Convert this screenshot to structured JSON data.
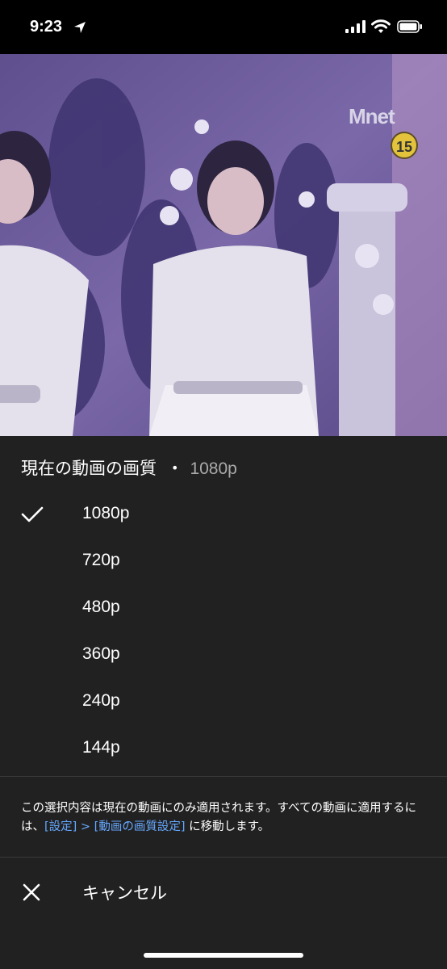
{
  "status_bar": {
    "time": "9:23"
  },
  "video": {
    "channel_logo": "Mnet",
    "age_rating": "15"
  },
  "quality_sheet": {
    "header_label": "現在の動画の画質",
    "separator": "•",
    "current_quality": "1080p",
    "options": [
      {
        "label": "1080p",
        "selected": true
      },
      {
        "label": "720p",
        "selected": false
      },
      {
        "label": "480p",
        "selected": false
      },
      {
        "label": "360p",
        "selected": false
      },
      {
        "label": "240p",
        "selected": false
      },
      {
        "label": "144p",
        "selected": false
      }
    ],
    "note_text": "この選択内容は現在の動画にのみ適用されます。すべての動画に適用するには、",
    "note_link": "[設定] > [動画の画質設定]",
    "note_suffix": " に移動します。",
    "cancel_label": "キャンセル"
  },
  "colors": {
    "sheet_background": "#212121",
    "link": "#65a8ff",
    "secondary_text": "#aaaaaa"
  },
  "icons": [
    "location-arrow-icon",
    "signal-icon",
    "wifi-icon",
    "battery-icon",
    "checkmark-icon",
    "close-icon"
  ]
}
